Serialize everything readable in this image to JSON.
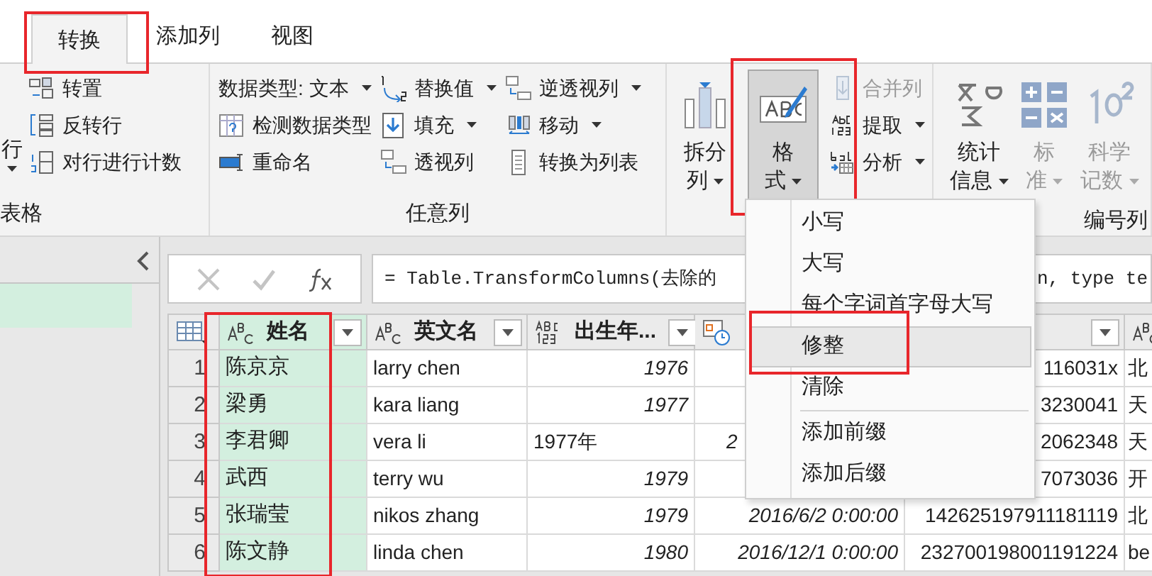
{
  "tabs": [
    {
      "label": "转换",
      "selected": true,
      "highlighted": true
    },
    {
      "label": "添加列",
      "selected": false
    },
    {
      "label": "视图",
      "selected": false
    }
  ],
  "ribbon": {
    "groups": [
      {
        "label": "表格",
        "cut_button": {
          "label": "行"
        },
        "small_buttons": [
          {
            "label": "转置",
            "dropdown": false,
            "disabled": false
          },
          {
            "label": "反转行",
            "dropdown": false,
            "disabled": false
          },
          {
            "label": "对行进行计数",
            "dropdown": false,
            "disabled": false
          }
        ]
      },
      {
        "label": "任意列",
        "small_buttons": [
          {
            "label": "数据类型: 文本",
            "dropdown": true,
            "disabled": false
          },
          {
            "label": "检测数据类型",
            "dropdown": false,
            "disabled": false
          },
          {
            "label": "重命名",
            "dropdown": false,
            "disabled": false
          },
          {
            "label": "替换值",
            "dropdown": true,
            "disabled": false
          },
          {
            "label": "填充",
            "dropdown": true,
            "disabled": false
          },
          {
            "label": "透视列",
            "dropdown": false,
            "disabled": false
          },
          {
            "label": "逆透视列",
            "dropdown": true,
            "disabled": false
          },
          {
            "label": "移动",
            "dropdown": true,
            "disabled": false
          },
          {
            "label": "转换为列表",
            "dropdown": false,
            "disabled": false
          }
        ]
      },
      {
        "big_buttons": [
          {
            "lines": [
              "拆分",
              "列"
            ],
            "dropdown": true,
            "disabled": false,
            "pressed": false
          },
          {
            "lines": [
              "格",
              "式"
            ],
            "dropdown": true,
            "disabled": false,
            "pressed": true,
            "highlighted": true
          }
        ],
        "small_buttons": [
          {
            "label": "合并列",
            "dropdown": false,
            "disabled": true
          },
          {
            "label": "提取",
            "dropdown": true,
            "disabled": false
          },
          {
            "label": "分析",
            "dropdown": true,
            "disabled": false
          }
        ]
      },
      {
        "label": "编号列",
        "big_buttons": [
          {
            "lines": [
              "统计",
              "信息"
            ],
            "dropdown": true,
            "disabled": false,
            "pressed": false
          },
          {
            "lines": [
              "标",
              "准"
            ],
            "dropdown": true,
            "disabled": true,
            "pressed": false
          },
          {
            "lines": [
              "科学",
              "记数"
            ],
            "dropdown": true,
            "disabled": true,
            "pressed": false
          }
        ]
      }
    ]
  },
  "formula_bar": {
    "formula_start": "= Table.TransformColumns(去除的",
    "formula_end": "n, type te"
  },
  "table": {
    "columns": [
      {
        "label": "姓名",
        "selected": true,
        "highlighted": true
      },
      {
        "label": "英文名",
        "selected": false
      },
      {
        "label": "出生年...",
        "selected": false
      },
      {
        "selected": false
      },
      {
        "selected": false
      },
      {
        "selected": false
      }
    ],
    "rows": [
      {
        "index": "1",
        "cells": [
          {
            "text": "陈京京"
          },
          {
            "text": "larry chen"
          },
          {
            "text": "1976",
            "kind": "number"
          },
          {},
          {
            "text": "116031x"
          },
          {
            "text": "北"
          }
        ]
      },
      {
        "index": "2",
        "cells": [
          {
            "text": "梁勇"
          },
          {
            "text": "kara liang"
          },
          {
            "text": "1977",
            "kind": "number"
          },
          {},
          {
            "text": "3230041"
          },
          {
            "text": "天"
          }
        ]
      },
      {
        "index": "3",
        "cells": [
          {
            "text": "李君卿"
          },
          {
            "text": "vera li"
          },
          {
            "text": "1977年",
            "kind": "text"
          },
          {
            "text": "2",
            "kind": "clipped"
          },
          {
            "text": "2062348"
          },
          {
            "text": "天"
          }
        ]
      },
      {
        "index": "4",
        "cells": [
          {
            "text": "武西"
          },
          {
            "text": "terry wu"
          },
          {
            "text": "1979",
            "kind": "number"
          },
          {},
          {
            "text": "7073036"
          },
          {
            "text": "开"
          }
        ]
      },
      {
        "index": "5",
        "cells": [
          {
            "text": "张瑞莹"
          },
          {
            "text": "nikos zhang"
          },
          {
            "text": "1979",
            "kind": "number"
          },
          {
            "text": "2016/6/2 0:00:00",
            "kind": "number"
          },
          {
            "text": "142625197911181119"
          },
          {
            "text": "北"
          }
        ]
      },
      {
        "index": "6",
        "cells": [
          {
            "text": "陈文静"
          },
          {
            "text": "linda chen"
          },
          {
            "text": "1980",
            "kind": "number"
          },
          {
            "text": "2016/12/1 0:00:00",
            "kind": "number"
          },
          {
            "text": "232700198001191224"
          },
          {
            "text": "be"
          }
        ]
      }
    ]
  },
  "menu": {
    "items": [
      {
        "kind": "item",
        "label": "小写",
        "hovered": false
      },
      {
        "kind": "item",
        "label": "大写",
        "hovered": false
      },
      {
        "kind": "item",
        "label": "每个字词首字母大写",
        "hovered": false
      },
      {
        "kind": "item",
        "label": "修整",
        "hovered": true,
        "highlighted": true
      },
      {
        "kind": "item",
        "label": "清除",
        "hovered": false
      },
      {
        "kind": "separator"
      },
      {
        "kind": "item",
        "label": "添加前缀",
        "hovered": false
      },
      {
        "kind": "item",
        "label": "添加后缀",
        "hovered": false
      }
    ]
  }
}
